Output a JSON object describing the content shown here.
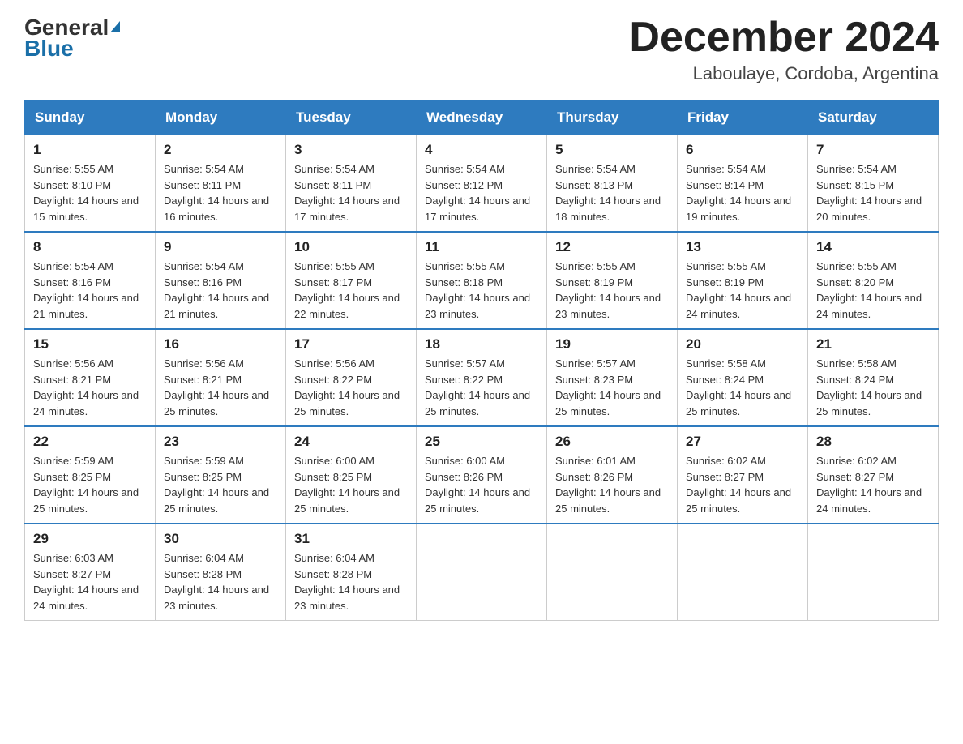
{
  "logo": {
    "general": "General",
    "blue": "Blue"
  },
  "title": "December 2024",
  "location": "Laboulaye, Cordoba, Argentina",
  "header_days": [
    "Sunday",
    "Monday",
    "Tuesday",
    "Wednesday",
    "Thursday",
    "Friday",
    "Saturday"
  ],
  "weeks": [
    [
      {
        "day": "1",
        "sunrise": "5:55 AM",
        "sunset": "8:10 PM",
        "daylight": "14 hours and 15 minutes."
      },
      {
        "day": "2",
        "sunrise": "5:54 AM",
        "sunset": "8:11 PM",
        "daylight": "14 hours and 16 minutes."
      },
      {
        "day": "3",
        "sunrise": "5:54 AM",
        "sunset": "8:11 PM",
        "daylight": "14 hours and 17 minutes."
      },
      {
        "day": "4",
        "sunrise": "5:54 AM",
        "sunset": "8:12 PM",
        "daylight": "14 hours and 17 minutes."
      },
      {
        "day": "5",
        "sunrise": "5:54 AM",
        "sunset": "8:13 PM",
        "daylight": "14 hours and 18 minutes."
      },
      {
        "day": "6",
        "sunrise": "5:54 AM",
        "sunset": "8:14 PM",
        "daylight": "14 hours and 19 minutes."
      },
      {
        "day": "7",
        "sunrise": "5:54 AM",
        "sunset": "8:15 PM",
        "daylight": "14 hours and 20 minutes."
      }
    ],
    [
      {
        "day": "8",
        "sunrise": "5:54 AM",
        "sunset": "8:16 PM",
        "daylight": "14 hours and 21 minutes."
      },
      {
        "day": "9",
        "sunrise": "5:54 AM",
        "sunset": "8:16 PM",
        "daylight": "14 hours and 21 minutes."
      },
      {
        "day": "10",
        "sunrise": "5:55 AM",
        "sunset": "8:17 PM",
        "daylight": "14 hours and 22 minutes."
      },
      {
        "day": "11",
        "sunrise": "5:55 AM",
        "sunset": "8:18 PM",
        "daylight": "14 hours and 23 minutes."
      },
      {
        "day": "12",
        "sunrise": "5:55 AM",
        "sunset": "8:19 PM",
        "daylight": "14 hours and 23 minutes."
      },
      {
        "day": "13",
        "sunrise": "5:55 AM",
        "sunset": "8:19 PM",
        "daylight": "14 hours and 24 minutes."
      },
      {
        "day": "14",
        "sunrise": "5:55 AM",
        "sunset": "8:20 PM",
        "daylight": "14 hours and 24 minutes."
      }
    ],
    [
      {
        "day": "15",
        "sunrise": "5:56 AM",
        "sunset": "8:21 PM",
        "daylight": "14 hours and 24 minutes."
      },
      {
        "day": "16",
        "sunrise": "5:56 AM",
        "sunset": "8:21 PM",
        "daylight": "14 hours and 25 minutes."
      },
      {
        "day": "17",
        "sunrise": "5:56 AM",
        "sunset": "8:22 PM",
        "daylight": "14 hours and 25 minutes."
      },
      {
        "day": "18",
        "sunrise": "5:57 AM",
        "sunset": "8:22 PM",
        "daylight": "14 hours and 25 minutes."
      },
      {
        "day": "19",
        "sunrise": "5:57 AM",
        "sunset": "8:23 PM",
        "daylight": "14 hours and 25 minutes."
      },
      {
        "day": "20",
        "sunrise": "5:58 AM",
        "sunset": "8:24 PM",
        "daylight": "14 hours and 25 minutes."
      },
      {
        "day": "21",
        "sunrise": "5:58 AM",
        "sunset": "8:24 PM",
        "daylight": "14 hours and 25 minutes."
      }
    ],
    [
      {
        "day": "22",
        "sunrise": "5:59 AM",
        "sunset": "8:25 PM",
        "daylight": "14 hours and 25 minutes."
      },
      {
        "day": "23",
        "sunrise": "5:59 AM",
        "sunset": "8:25 PM",
        "daylight": "14 hours and 25 minutes."
      },
      {
        "day": "24",
        "sunrise": "6:00 AM",
        "sunset": "8:25 PM",
        "daylight": "14 hours and 25 minutes."
      },
      {
        "day": "25",
        "sunrise": "6:00 AM",
        "sunset": "8:26 PM",
        "daylight": "14 hours and 25 minutes."
      },
      {
        "day": "26",
        "sunrise": "6:01 AM",
        "sunset": "8:26 PM",
        "daylight": "14 hours and 25 minutes."
      },
      {
        "day": "27",
        "sunrise": "6:02 AM",
        "sunset": "8:27 PM",
        "daylight": "14 hours and 25 minutes."
      },
      {
        "day": "28",
        "sunrise": "6:02 AM",
        "sunset": "8:27 PM",
        "daylight": "14 hours and 24 minutes."
      }
    ],
    [
      {
        "day": "29",
        "sunrise": "6:03 AM",
        "sunset": "8:27 PM",
        "daylight": "14 hours and 24 minutes."
      },
      {
        "day": "30",
        "sunrise": "6:04 AM",
        "sunset": "8:28 PM",
        "daylight": "14 hours and 23 minutes."
      },
      {
        "day": "31",
        "sunrise": "6:04 AM",
        "sunset": "8:28 PM",
        "daylight": "14 hours and 23 minutes."
      },
      null,
      null,
      null,
      null
    ]
  ],
  "labels": {
    "sunrise": "Sunrise: ",
    "sunset": "Sunset: ",
    "daylight": "Daylight: "
  }
}
